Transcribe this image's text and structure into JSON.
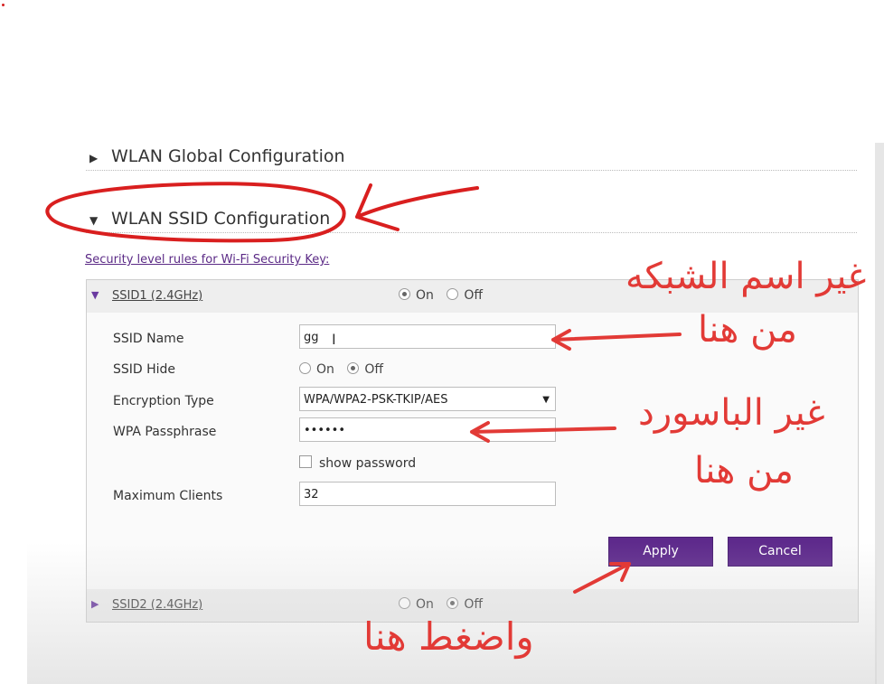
{
  "sections": {
    "global": {
      "label": "WLAN Global Configuration",
      "icon": "collapsed-triangle-icon"
    },
    "ssid": {
      "label": "WLAN SSID Configuration",
      "icon": "expanded-triangle-icon"
    }
  },
  "security_link": "Security level rules for Wi-Fi Security Key:",
  "ssid1": {
    "name": "SSID1 (2.4GHz)",
    "on_label": "On",
    "off_label": "Off",
    "state": "On"
  },
  "ssid2": {
    "name": "SSID2 (2.4GHz)",
    "on_label": "On",
    "off_label": "Off",
    "state": "Off"
  },
  "form": {
    "ssid_name_label": "SSID Name",
    "ssid_name_value": "gg",
    "ssid_hide_label": "SSID Hide",
    "hide_on_label": "On",
    "hide_off_label": "Off",
    "hide_state": "Off",
    "encryption_label": "Encryption Type",
    "encryption_value": "WPA/WPA2-PSK-TKIP/AES",
    "passphrase_label": "WPA Passphrase",
    "passphrase_value": "••••••",
    "show_password_label": "show password",
    "show_password_checked": false,
    "max_clients_label": "Maximum Clients",
    "max_clients_value": "32"
  },
  "buttons": {
    "apply": "Apply",
    "cancel": "Cancel"
  },
  "annotations": {
    "change_network_name_1": "غير اسم الشبكه",
    "change_network_name_2": "من هنا",
    "change_password_1": "غير الباسورد",
    "change_password_2": "من هنا",
    "press_here": "واضغط هنا"
  },
  "colors": {
    "accent": "#5e2a8c",
    "annotation": "#e23a36"
  }
}
